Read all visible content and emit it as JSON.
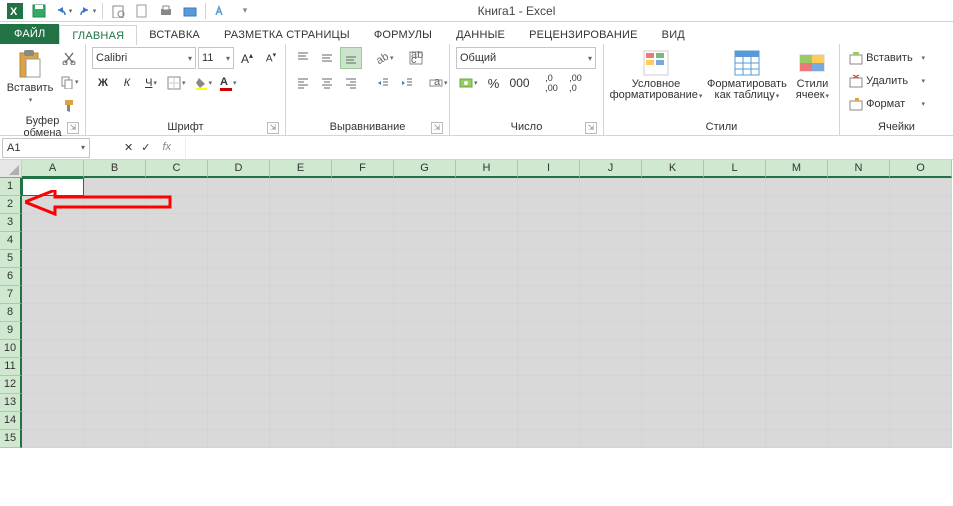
{
  "title": "Книга1 - Excel",
  "tabs": {
    "file": "ФАЙЛ",
    "home": "ГЛАВНАЯ",
    "insert": "ВСТАВКА",
    "pagelayout": "РАЗМЕТКА СТРАНИЦЫ",
    "formulas": "ФОРМУЛЫ",
    "data": "ДАННЫЕ",
    "review": "РЕЦЕНЗИРОВАНИЕ",
    "view": "ВИД"
  },
  "clipboard": {
    "paste": "Вставить",
    "label": "Буфер обмена"
  },
  "font": {
    "name": "Calibri",
    "size": "11",
    "label": "Шрифт"
  },
  "alignment": {
    "label": "Выравнивание"
  },
  "number": {
    "format": "Общий",
    "label": "Число"
  },
  "styles": {
    "cond": "Условное форматирование",
    "table": "Форматировать как таблицу",
    "cell": "Стили ячеек",
    "label": "Стили"
  },
  "cells": {
    "insert": "Вставить",
    "delete": "Удалить",
    "format": "Формат",
    "label": "Ячейки"
  },
  "namebox": "A1",
  "columns": [
    "A",
    "B",
    "C",
    "D",
    "E",
    "F",
    "G",
    "H",
    "I",
    "J",
    "K",
    "L",
    "M",
    "N",
    "O"
  ],
  "rows": [
    "1",
    "2",
    "3",
    "4",
    "5",
    "6",
    "7",
    "8",
    "9",
    "10",
    "11",
    "12",
    "13",
    "14",
    "15"
  ]
}
